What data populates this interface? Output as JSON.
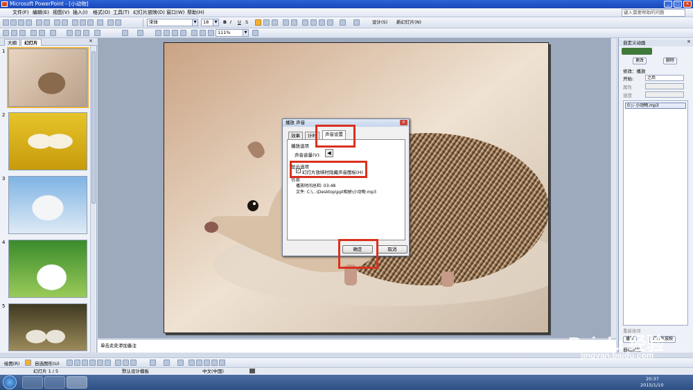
{
  "window": {
    "title": "Microsoft PowerPoint - [小动物]"
  },
  "menu": {
    "items": [
      "文件(F)",
      "编辑(E)",
      "视图(V)",
      "插入(I)",
      "格式(O)",
      "工具(T)",
      "幻灯片放映(D)",
      "窗口(W)",
      "帮助(H)"
    ],
    "help_placeholder": "键入需要帮助的问题"
  },
  "format_toolbar": {
    "font": "宋体",
    "size": "18",
    "bold": "B",
    "italic": "I",
    "underline": "U",
    "shadow": "S",
    "design": "设计(S)",
    "new_slide": "新幻灯片(N)"
  },
  "standard_toolbar": {
    "zoom": "111%"
  },
  "slides_pane": {
    "tabs": [
      "大纲",
      "幻灯片"
    ],
    "numbers": [
      "1",
      "2",
      "3",
      "4",
      "5"
    ]
  },
  "notes": {
    "placeholder": "单击此处添加备注"
  },
  "task_pane": {
    "title": "自定义动画",
    "change_button": "更改",
    "delete_button": "删除",
    "effect_label": "修改：播放",
    "start_label": "开始:",
    "start_value": "之后",
    "property_label": "属性",
    "speed_label": "速度",
    "list_item": "0 ▷ 小动物.mp3",
    "reorder_label": "重新排序",
    "play_button": "播放",
    "slideshow_button": "幻灯片放映",
    "autopreview": "自动预览"
  },
  "dialog": {
    "title": "播放 声音",
    "tabs": [
      "效果",
      "计时",
      "声音设置"
    ],
    "play_options_heading": "播放选项",
    "volume_label": "声音音量(V):",
    "display_options_heading": "显示选项",
    "hide_icon_checkbox": "幻灯片放映时隐藏声音图标(H)",
    "hide_icon_checked": true,
    "info_heading": "信息",
    "play_time": "播放时间总和:  03:48",
    "file": "文件:  C:\\...\\Desktop\\ppt相册\\小动物.mp3",
    "ok_button": "确定",
    "cancel_button": "取消"
  },
  "drawing_toolbar": {
    "draw_label": "绘图(R)",
    "autoshapes_label": "自选图形(U)"
  },
  "statusbar": {
    "slide": "幻灯片 1 / 5",
    "template": "默认设计模板",
    "language": "中文(中国)"
  },
  "taskbar": {
    "time": "20:37",
    "date": "2015/1/10"
  },
  "watermark": {
    "logo": "Bai du 经验",
    "url": "jingyan.baidu.com"
  }
}
